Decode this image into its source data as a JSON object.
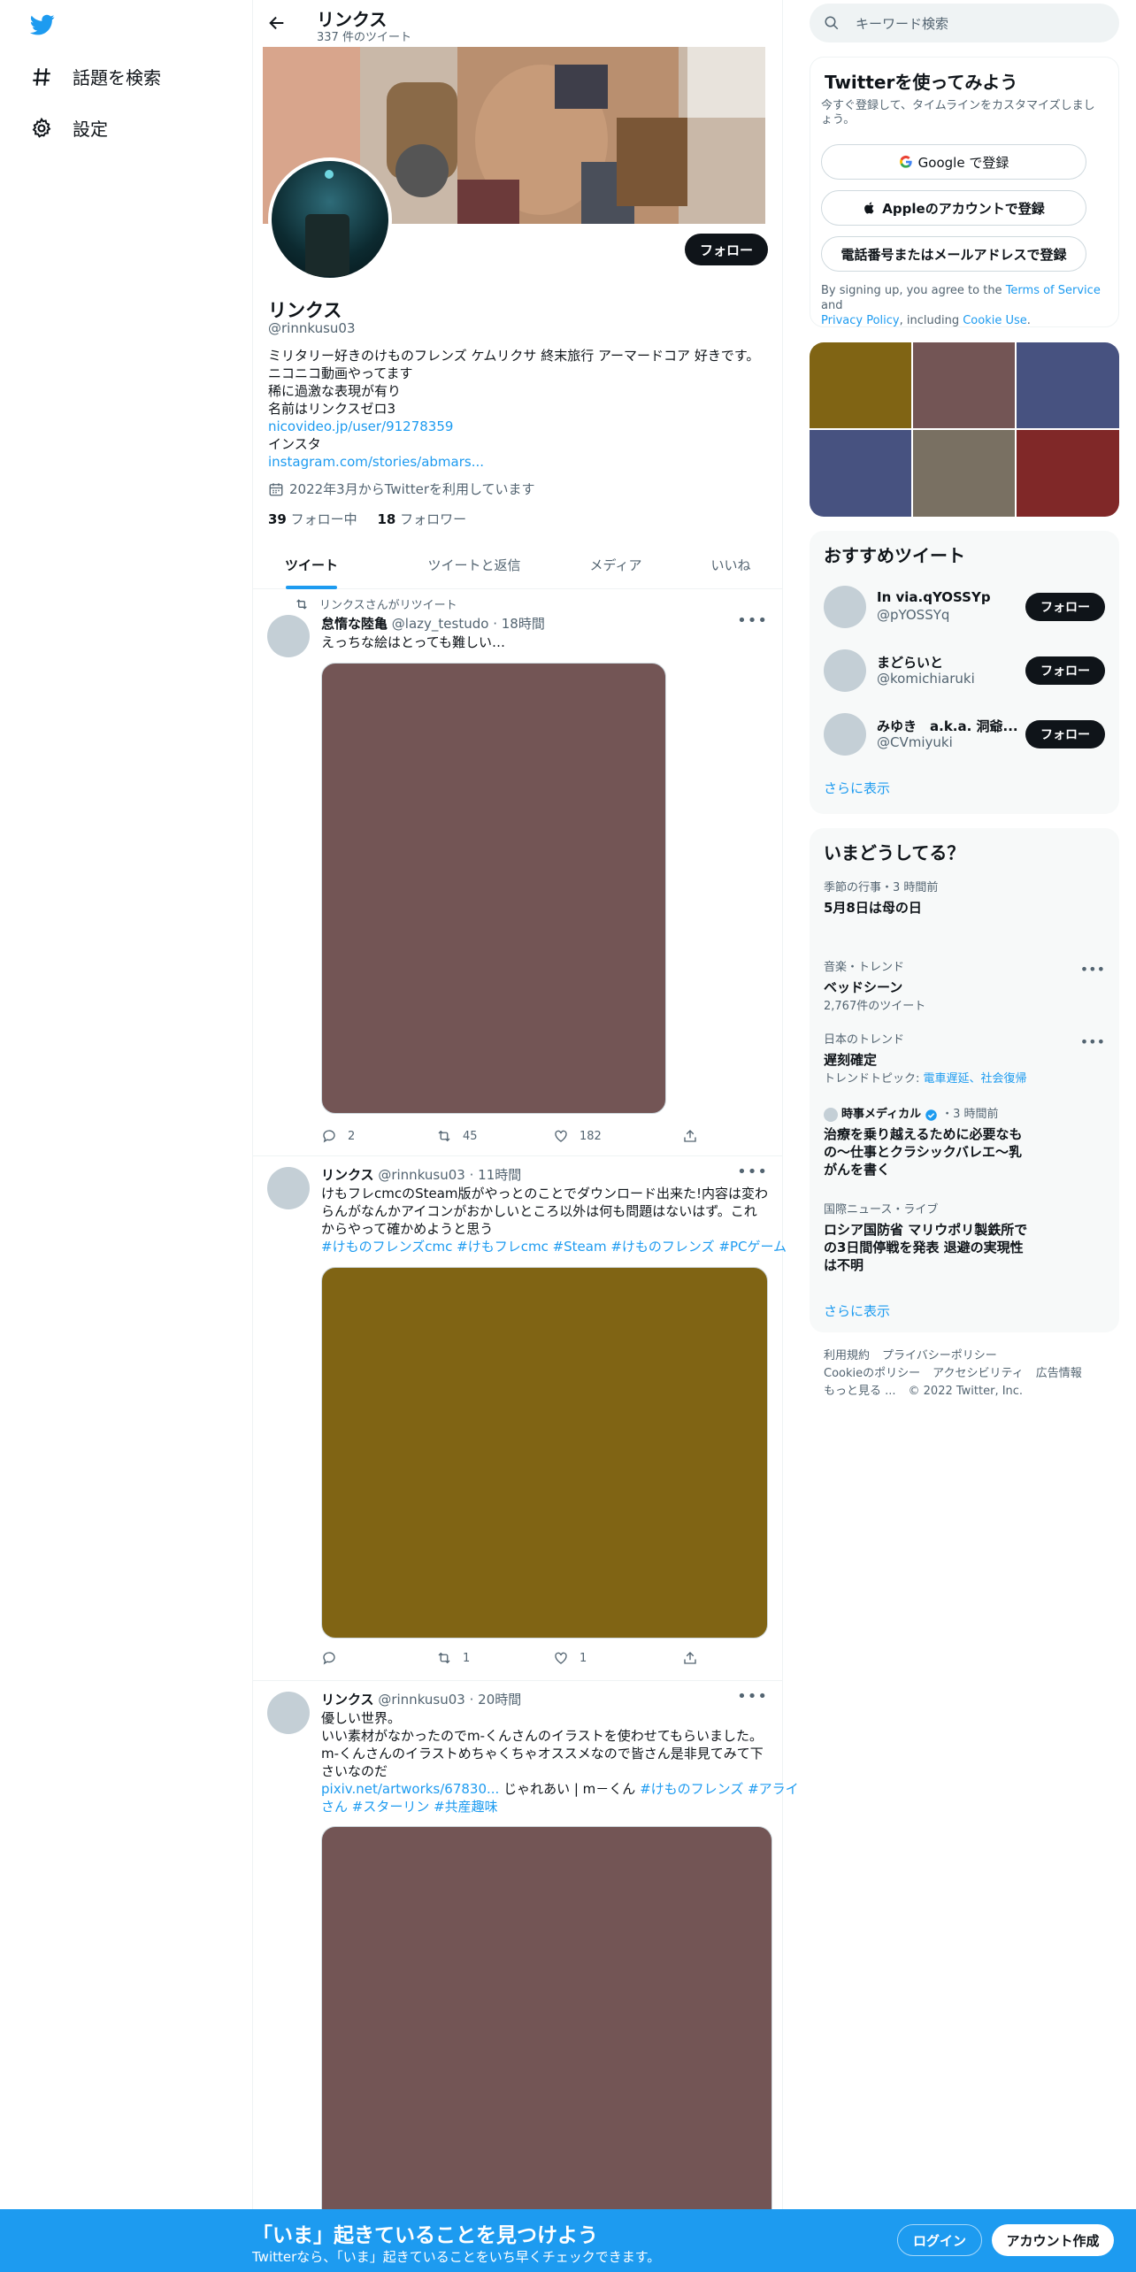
{
  "nav": {
    "explore_label": "話題を検索",
    "settings_label": "設定"
  },
  "header": {
    "name": "リンクス",
    "tweet_count": "337 件のツイート"
  },
  "profile": {
    "follow_label": "フォロー",
    "name": "リンクス",
    "handle": "@rinnkusu03",
    "bio_lines": [
      "ミリタリー好きのけものフレンズ ケムリクサ 終末旅行 アーマードコア 好きです。",
      "ニコニコ動画やってます",
      "稀に過激な表現が有り",
      "名前はリンクスゼロ3"
    ],
    "link1": "nicovideo.jp/user/91278359",
    "bio_line5": "インスタ",
    "link2": "instagram.com/stories/abmars...",
    "joined": "2022年3月からTwitterを利用しています",
    "following_count": "39",
    "following_label": "フォロー中",
    "followers_count": "18",
    "followers_label": "フォロワー"
  },
  "tabs": [
    "ツイート",
    "ツイートと返信",
    "メディア",
    "いいね"
  ],
  "tweets": [
    {
      "retweet_label": "リンクスさんがリツイート",
      "name": "怠惰な陸亀",
      "handle": "@lazy_testudo",
      "time": "18時間",
      "text": "えっちな絵はとっても難しい…",
      "media_color": "#735555",
      "replies": "2",
      "retweets": "45",
      "likes": "182"
    },
    {
      "name": "リンクス",
      "handle": "@rinnkusu03",
      "time": "11時間",
      "text_lines": [
        "けもフレcmcのSteam版がやっとのことでダウンロード出来た!内容は変わ",
        "らんがなんかアイコンがおかしいところ以外は何も問題はないはず。これ",
        "からやって確かめようと思う"
      ],
      "hashtags": "#けものフレンズcmc #けもフレcmc #Steam #けものフレンズ #PCゲーム",
      "media_color": "#806414",
      "replies": "",
      "retweets": "1",
      "likes": "1"
    },
    {
      "name": "リンクス",
      "handle": "@rinnkusu03",
      "time": "20時間",
      "text_lines": [
        "優しい世界。",
        "いい素材がなかったのでm-くんさんのイラストを使わせてもらいました。",
        "m-くんさんのイラストめちゃくちゃオススメなので皆さん是非見てみて下",
        "さいなのだ"
      ],
      "link": "pixiv.net/artworks/67830...",
      "link_after": " じゃれあい | m－くん ",
      "hashtags_line1": "#けものフレンズ #アライ",
      "hashtags_line2": "さん #スターリン #共産趣味",
      "media_color": "#735555"
    }
  ],
  "right": {
    "search_placeholder": "キーワード検索",
    "signup": {
      "title": "Twitterを使ってみよう",
      "subtitle_line1": "今すぐ登録して、タイムラインをカスタマイズしまし",
      "subtitle_line2": "ょう。",
      "google": "Google で登録",
      "apple": "Appleのアカウントで登録",
      "phone": "電話番号またはメールアドレスで登録",
      "terms_pre": "By signing up, you agree to the ",
      "terms_link": "Terms of Service",
      "terms_and": " and",
      "privacy_link": "Privacy Policy",
      "including": ", including ",
      "cookie_link": "Cookie Use",
      "period": "."
    },
    "grid_colors": [
      "#806414",
      "#735555",
      "#475280",
      "#475280",
      "#797062",
      "#802828"
    ],
    "who_to_follow": {
      "title": "おすすめツイート",
      "users": [
        {
          "name": "In via.qYOSSYp",
          "handle": "@pYOSSYq"
        },
        {
          "name": "まどらいと",
          "handle": "@komichiaruki"
        },
        {
          "name": "みゆき　a.k.a. 洞爺...",
          "handle": "@CVmiyuki"
        }
      ],
      "follow_label": "フォロー",
      "show_more": "さらに表示"
    },
    "trends": {
      "title": "いまどうしてる？",
      "items": [
        {
          "meta": "季節の行事・3 時間前",
          "title": "5月8日は母の日"
        },
        {
          "meta": "音楽・トレンド",
          "title": "ベッドシーン",
          "sub": "2,767件のツイート"
        },
        {
          "meta": "日本のトレンド",
          "title": "遅刻確定",
          "sub_pre": "トレンドトピック: ",
          "sub_link": "電車遅延、社会復帰"
        },
        {
          "meta_source": "時事メディカル",
          "meta_time": "・3 時間前",
          "title_lines": [
            "治療を乗り越えるために必要なも",
            "の～仕事とクラシックバレエ～乳",
            "がんを書く"
          ]
        },
        {
          "meta": "国際ニュース・ライブ",
          "title_lines": [
            "ロシア国防省 マリウポリ製鉄所で",
            "の3日間停戦を発表 退避の実現性",
            "は不明"
          ]
        }
      ],
      "show_more": "さらに表示"
    },
    "footer": {
      "line1": [
        "利用規約",
        "プライバシーポリシー"
      ],
      "line2": [
        "Cookieのポリシー",
        "アクセシビリティ",
        "広告情報"
      ],
      "more": "もっと見る ...",
      "copyright": "© 2022 Twitter, Inc."
    }
  },
  "bottom_bar": {
    "title": "「いま」起きていることを見つけよう",
    "subtitle": "Twitterなら、「いま」起きていることをいち早くチェックできます。",
    "login": "ログイン",
    "signup": "アカウント作成"
  },
  "colors": {
    "accent": "#1d9bf0",
    "text": "#0f1419",
    "muted": "#536471"
  }
}
